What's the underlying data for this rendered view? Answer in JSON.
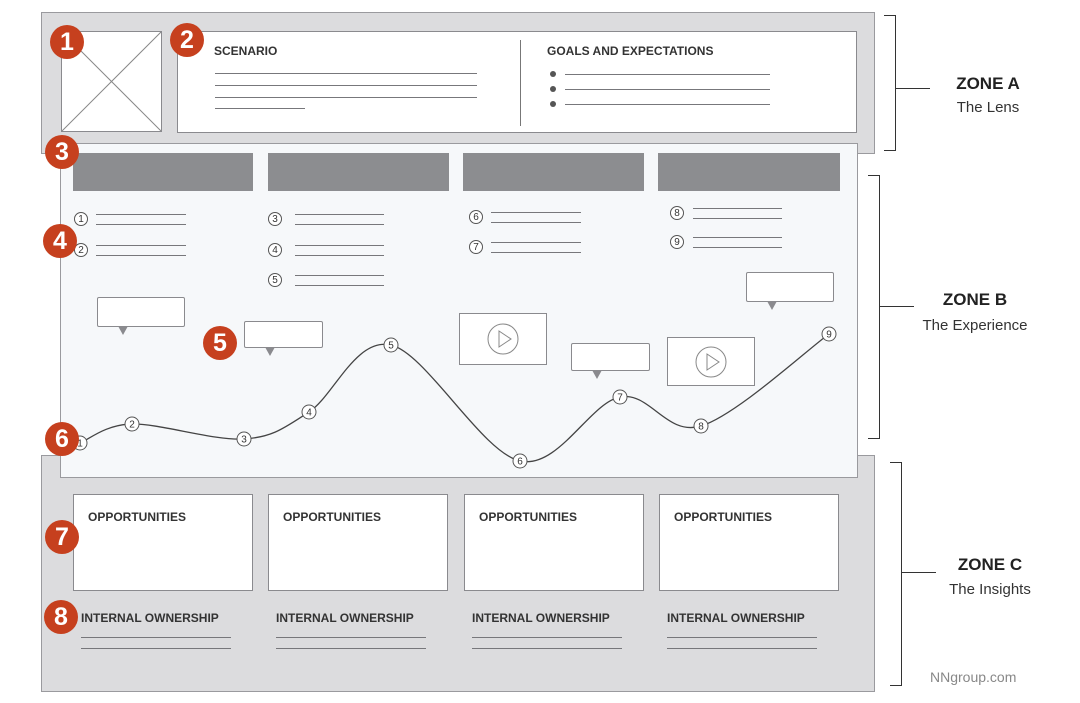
{
  "zone_a": {
    "name": "ZONE A",
    "subtitle": "The Lens",
    "scenario_title": "SCENARIO",
    "goals_title": "GOALS AND EXPECTATIONS"
  },
  "zone_b": {
    "name": "ZONE B",
    "subtitle": "The Experience"
  },
  "zone_c": {
    "name": "ZONE C",
    "subtitle": "The Insights",
    "opportunities": [
      "OPPORTUNITIES",
      "OPPORTUNITIES",
      "OPPORTUNITIES",
      "OPPORTUNITIES"
    ],
    "ownership": [
      "INTERNAL OWNERSHIP",
      "INTERNAL OWNERSHIP",
      "INTERNAL OWNERSHIP",
      "INTERNAL OWNERSHIP"
    ]
  },
  "badges": [
    "1",
    "2",
    "3",
    "4",
    "5",
    "6",
    "7",
    "8"
  ],
  "steps": [
    "1",
    "2",
    "3",
    "4",
    "5",
    "6",
    "7",
    "8",
    "9"
  ],
  "curve_points": [
    "1",
    "2",
    "3",
    "4",
    "5",
    "6",
    "7",
    "8",
    "9"
  ],
  "credit": "NNgroup.com",
  "colors": {
    "badge": "#c6401e",
    "zone": "#dcdcde",
    "phase_bar": "#8c8d90"
  }
}
